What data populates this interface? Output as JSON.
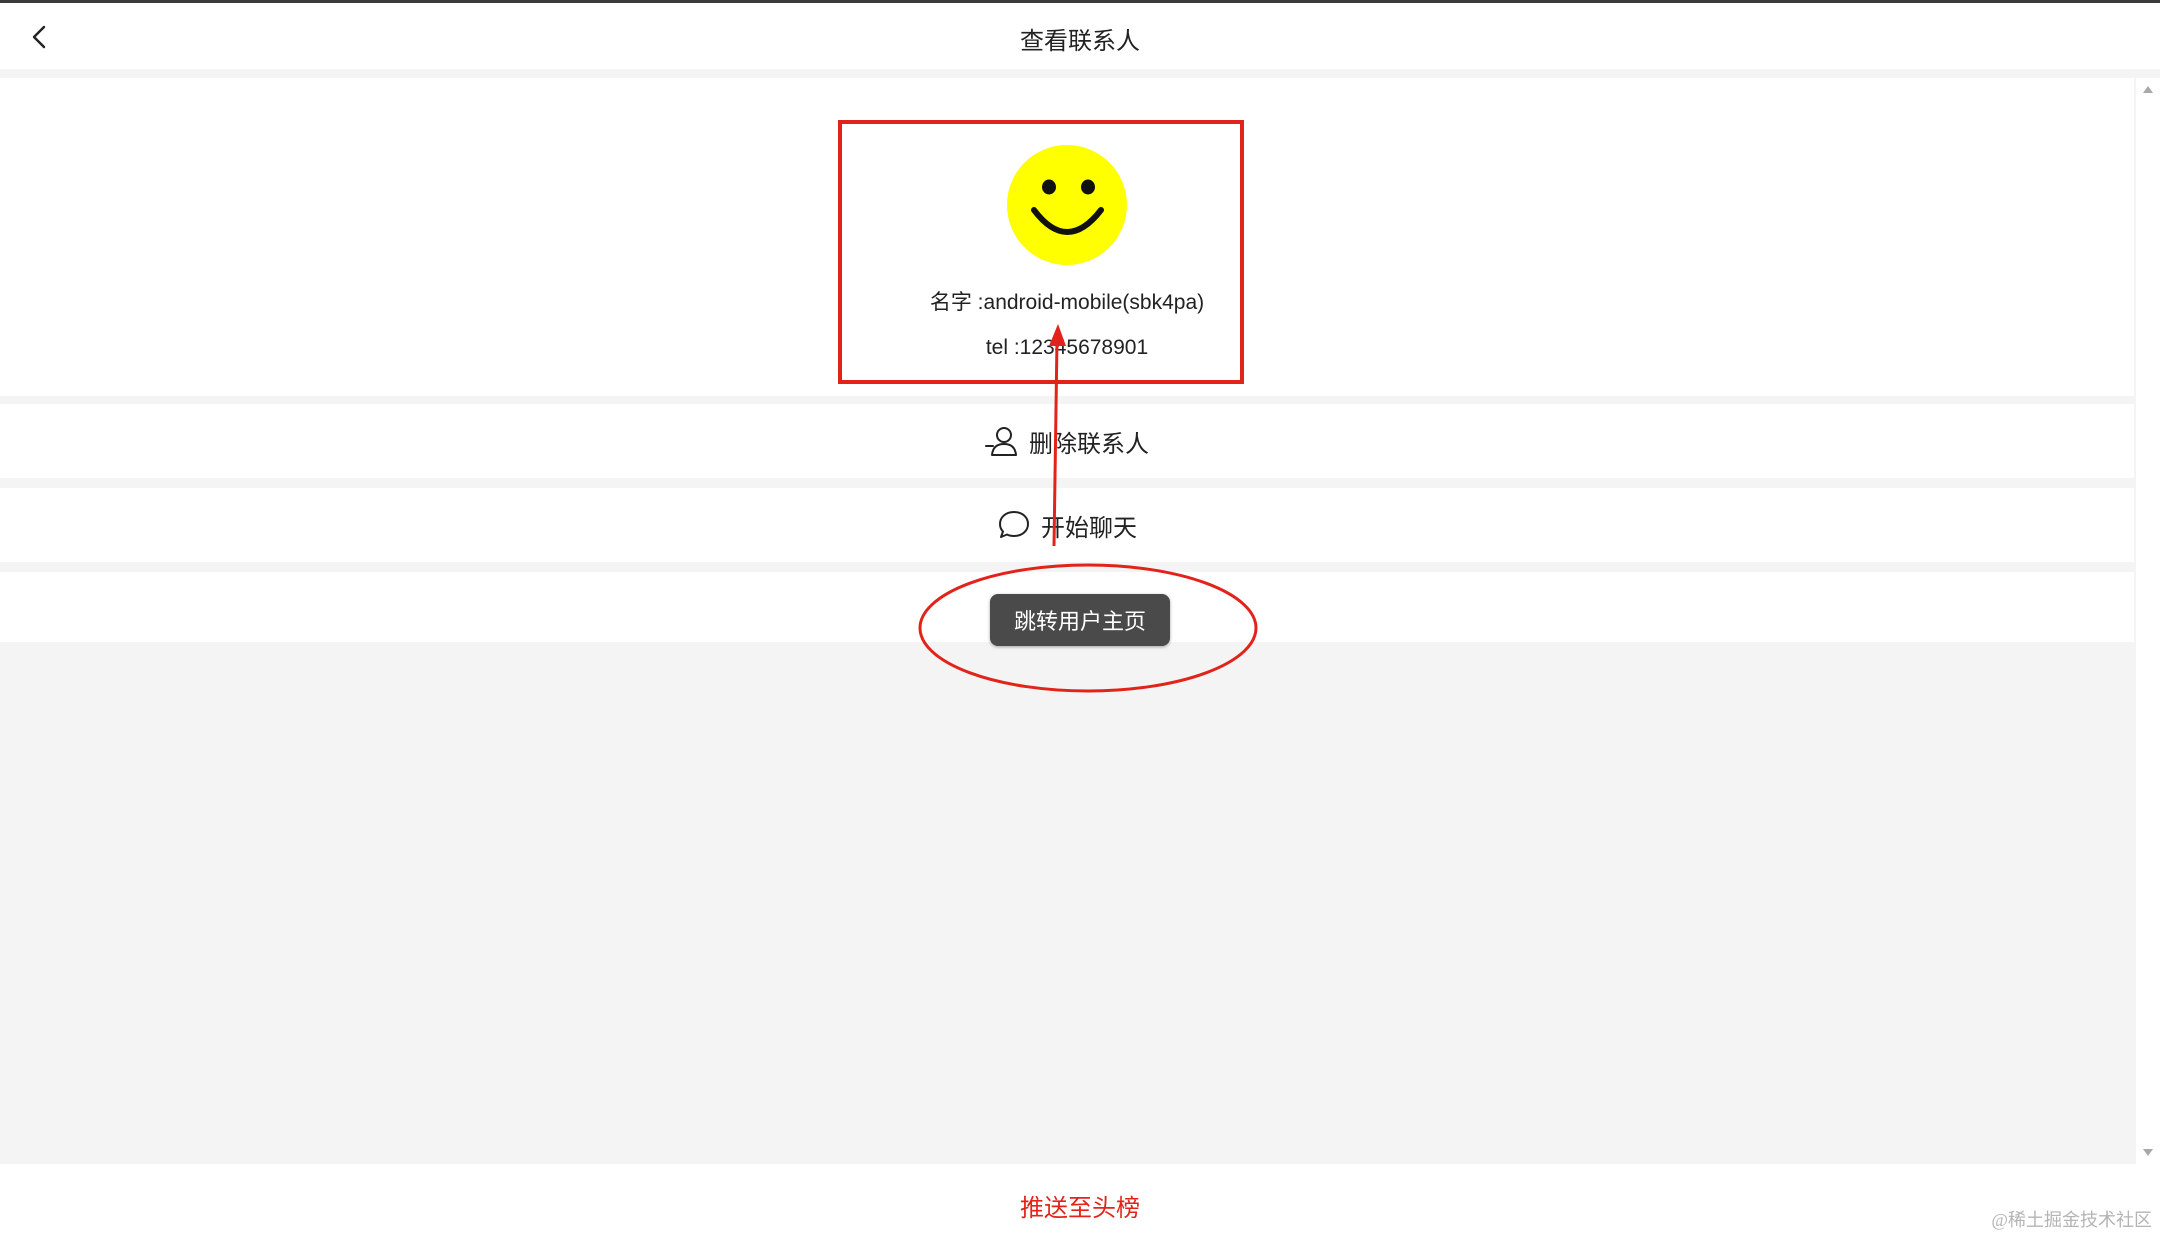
{
  "nav": {
    "title": "查看联系人",
    "back_icon": "chevron-left-icon"
  },
  "profile": {
    "avatar_icon": "smiley-face-icon",
    "avatar_color": "#ffff00",
    "name_text": "名字 :android-mobile(sbk4pa)",
    "tel_text": "tel :12345678901"
  },
  "actions": {
    "delete_label": "删除联系人",
    "delete_icon": "user-remove-icon",
    "chat_label": "开始聊天",
    "chat_icon": "chat-bubble-icon"
  },
  "toast": {
    "label": "跳转用户主页"
  },
  "bottom": {
    "push_label": "推送至头榜",
    "watermark": "@稀土掘金技术社区"
  },
  "colors": {
    "accent_red": "#e2231a",
    "page_bg": "#f4f4f4",
    "toast_bg": "#4a4a4a"
  }
}
